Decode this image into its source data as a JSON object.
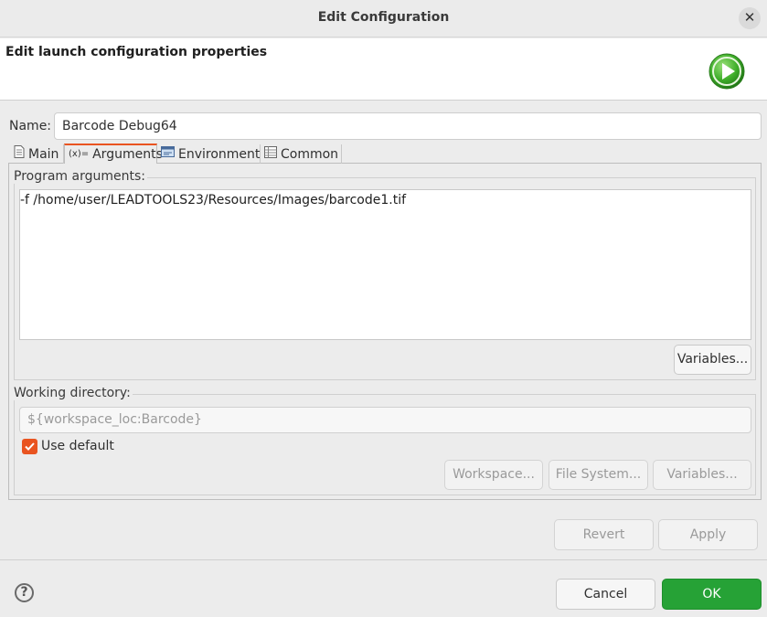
{
  "window": {
    "title": "Edit Configuration",
    "close_glyph": "✕"
  },
  "header": {
    "title": "Edit launch configuration properties",
    "icon": "run-icon"
  },
  "name": {
    "label": "Name:",
    "value": "Barcode Debug64"
  },
  "tabs": [
    {
      "label": "Main",
      "icon": "document-icon",
      "active": false
    },
    {
      "label": "Arguments",
      "icon": "variable-x-icon",
      "active": true
    },
    {
      "label": "Environment",
      "icon": "environment-icon",
      "active": false
    },
    {
      "label": "Common",
      "icon": "table-icon",
      "active": false
    }
  ],
  "program_arguments": {
    "label": "Program arguments:",
    "value": "-f /home/user/LEADTOOLS23/Resources/Images/barcode1.tif",
    "variables_button": "Variables..."
  },
  "working_directory": {
    "label": "Working directory:",
    "value": "${workspace_loc:Barcode}",
    "use_default_label": "Use default",
    "use_default_checked": true,
    "workspace_button": "Workspace...",
    "file_system_button": "File System...",
    "variables_button": "Variables..."
  },
  "actions": {
    "revert": "Revert",
    "apply": "Apply"
  },
  "footer": {
    "help_glyph": "?",
    "cancel": "Cancel",
    "ok": "OK"
  },
  "colors": {
    "accent": "#e95420",
    "ok_button": "#26a236",
    "run_icon_green": "#3fae2a"
  }
}
